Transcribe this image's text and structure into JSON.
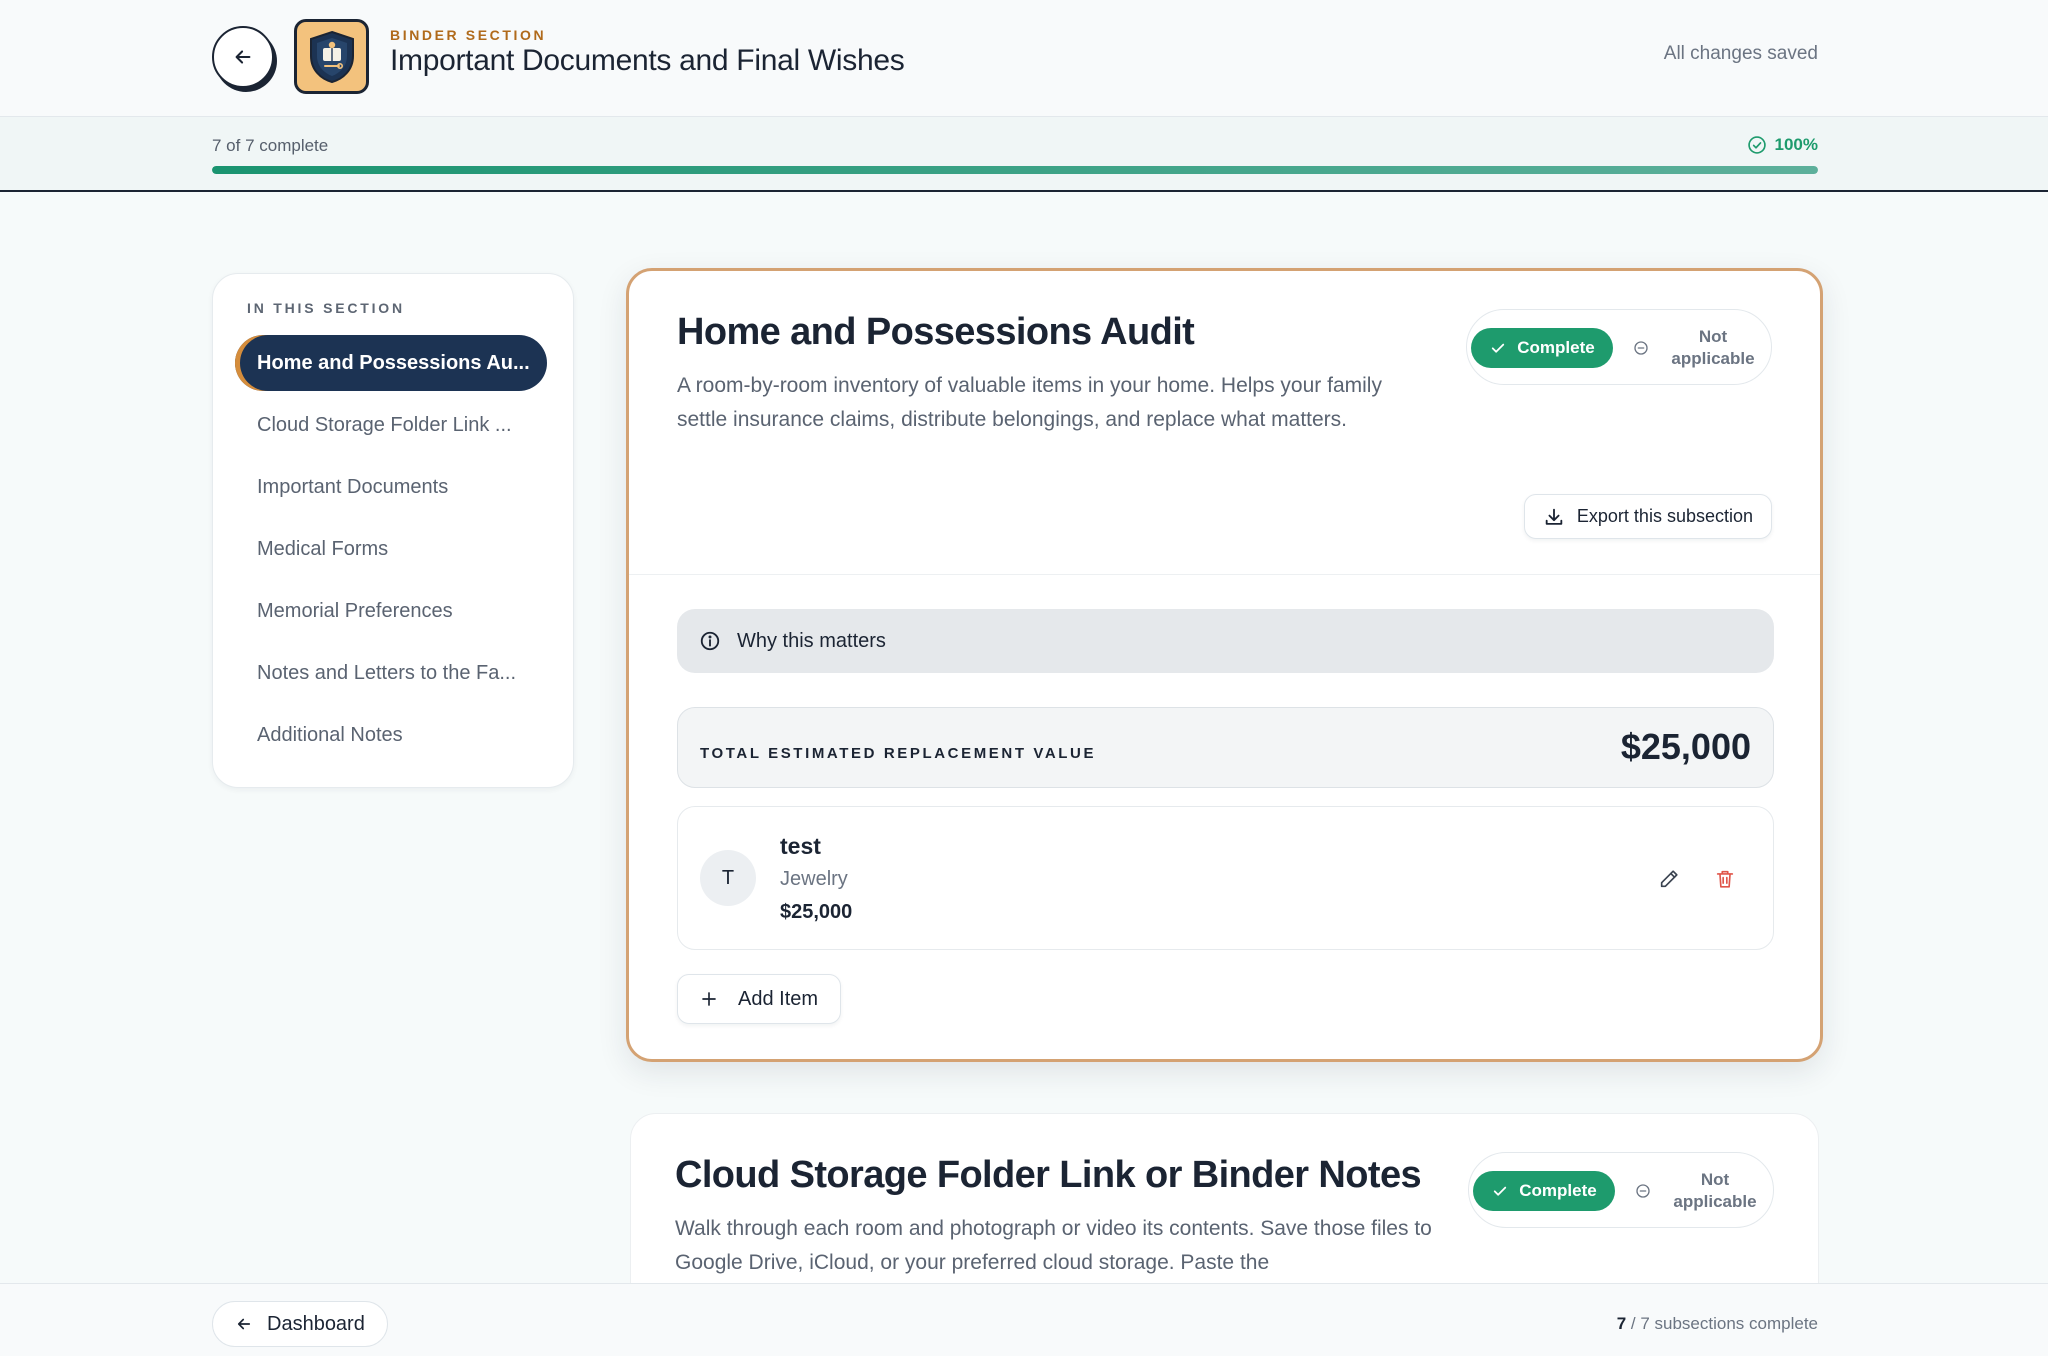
{
  "header": {
    "eyebrow": "BINDER SECTION",
    "title": "Important Documents and Final Wishes",
    "save_status": "All changes saved"
  },
  "progress": {
    "label": "7 of 7 complete",
    "percent_text": "100%",
    "fraction": 1.0
  },
  "sidebar": {
    "heading": "IN THIS SECTION",
    "items": [
      {
        "label": "Home and Possessions Au...",
        "active": true
      },
      {
        "label": "Cloud Storage Folder Link ...",
        "active": false
      },
      {
        "label": "Important Documents",
        "active": false
      },
      {
        "label": "Medical Forms",
        "active": false
      },
      {
        "label": "Memorial Preferences",
        "active": false
      },
      {
        "label": "Notes and Letters to the Fa...",
        "active": false
      },
      {
        "label": "Additional Notes",
        "active": false
      }
    ]
  },
  "main_card": {
    "title": "Home and Possessions Audit",
    "description": "A room-by-room inventory of valuable items in your home. Helps your family settle insurance claims, distribute belongings, and replace what matters.",
    "complete_label": "Complete",
    "na_label": "Not applicable",
    "export_label": "Export this subsection",
    "why_label": "Why this matters",
    "total_label": "TOTAL ESTIMATED REPLACEMENT VALUE",
    "total_value": "$25,000",
    "items": [
      {
        "initial": "T",
        "name": "test",
        "category": "Jewelry",
        "value": "$25,000"
      }
    ],
    "add_label": "Add Item"
  },
  "second_card": {
    "title": "Cloud Storage Folder Link or Binder Notes",
    "description": "Walk through each room and photograph or video its contents. Save those files to Google Drive, iCloud, or your preferred cloud storage. Paste the",
    "complete_label": "Complete",
    "na_label": "Not applicable"
  },
  "footer": {
    "dashboard_label": "Dashboard",
    "count_done": "7",
    "count_rest": "/ 7 subsections complete"
  },
  "colors": {
    "navy": "#1c3353",
    "accent_orange": "#d4a273",
    "success_green": "#1e9b6d",
    "danger_red": "#e0564a",
    "logo_bg": "#f3c27d"
  },
  "icons": {
    "back": "arrow-left-icon",
    "logo": "shield-crest-icon",
    "progress": "check-circle-icon",
    "complete": "check-icon",
    "not_applicable": "minus-circle-icon",
    "export": "download-icon",
    "info": "info-circle-icon",
    "edit": "pencil-icon",
    "delete": "trash-icon",
    "add": "plus-icon"
  }
}
